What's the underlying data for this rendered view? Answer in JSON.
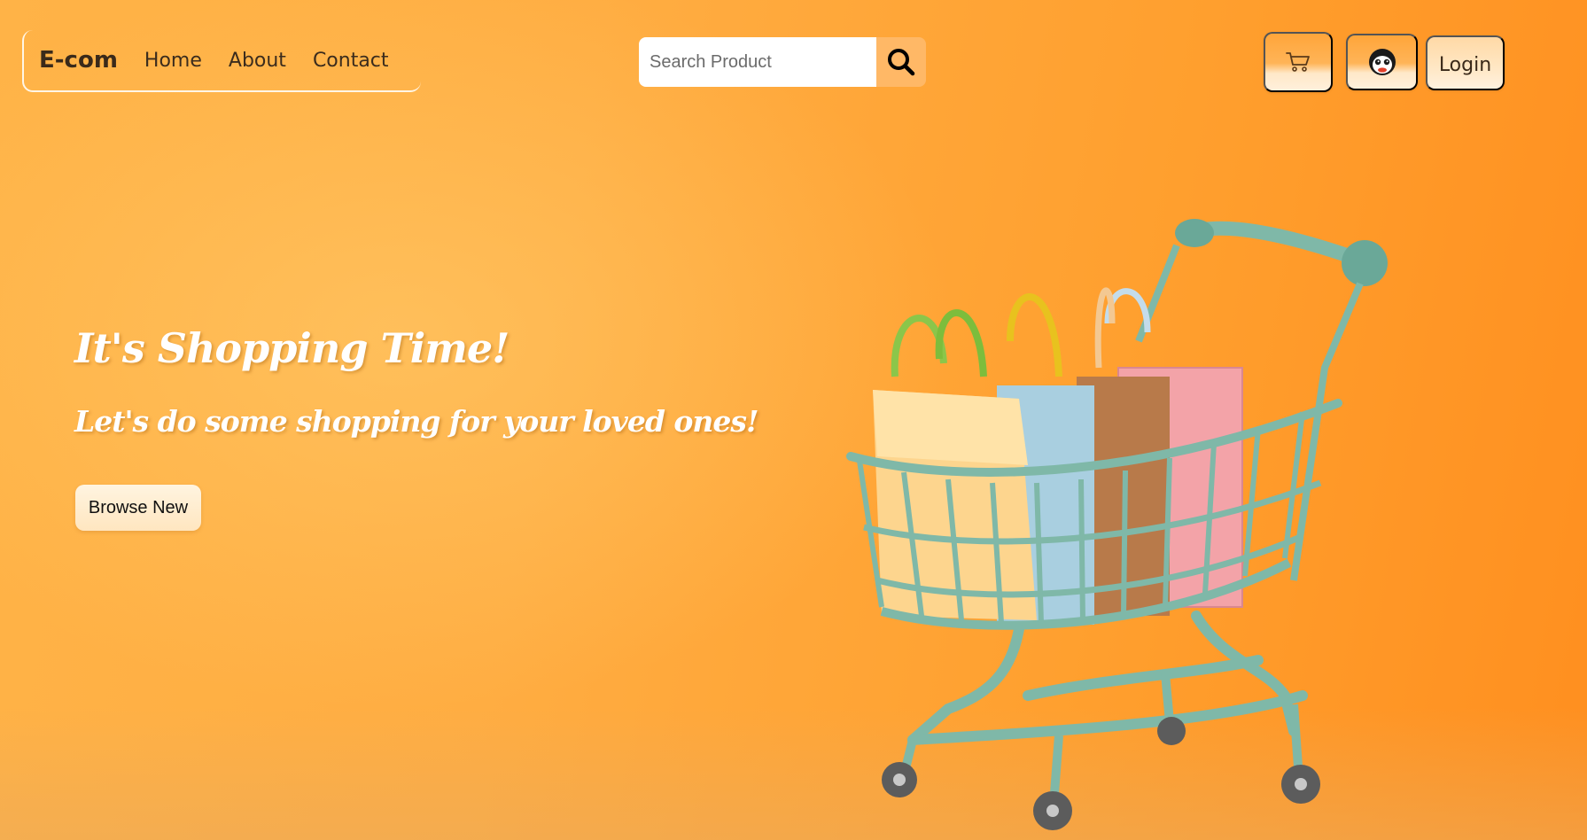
{
  "header": {
    "brand": "E-com",
    "nav": [
      {
        "label": "Home"
      },
      {
        "label": "About"
      },
      {
        "label": "Contact"
      }
    ],
    "search": {
      "placeholder": "Search Product",
      "value": "",
      "button_icon": "search-icon"
    },
    "cart_icon": "cart-icon",
    "avatar_icon": "avatar-icon",
    "login_label": "Login"
  },
  "hero": {
    "title": "It's Shopping   Time!",
    "subtitle": "Let's do some shopping for your loved ones!",
    "cta_label": "Browse New",
    "image": "shopping-cart-with-bags"
  },
  "colors": {
    "background_start": "#ffb347",
    "background_end": "#ff8f1f",
    "cart_teal": "#7fb8a8",
    "hero_text": "#ffffff",
    "button_cream": "#ffe6c0"
  }
}
